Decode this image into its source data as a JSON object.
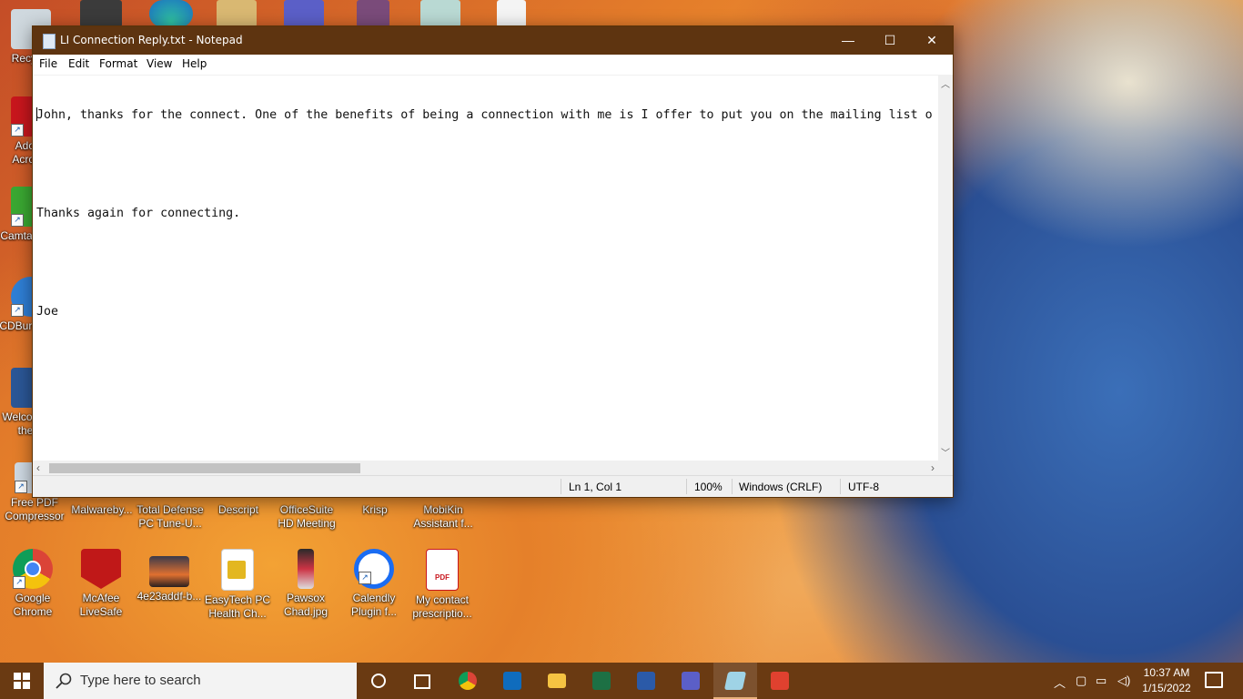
{
  "desktop": {
    "left_icons": [
      {
        "label": "Recycle",
        "icon": "recycle-bin-icon"
      },
      {
        "label": "Adobe Acrobat",
        "icon": "acrobat-icon"
      },
      {
        "label": "Camtasia 20",
        "icon": "camtasia-icon"
      },
      {
        "label": "CDBurnerXP",
        "icon": "cdburner-icon"
      },
      {
        "label": "Welcome to the w",
        "icon": "word-doc-icon"
      }
    ],
    "row1_icons": [
      {
        "label": "Free PDF Compressor",
        "icon": "pdf-compressor-icon"
      },
      {
        "label": "Malwareby...",
        "icon": "malwarebytes-icon"
      },
      {
        "label": "Total Defense PC Tune-U...",
        "icon": "total-defense-icon"
      },
      {
        "label": "Descript",
        "icon": "descript-icon"
      },
      {
        "label": "OfficeSuite HD Meeting",
        "icon": "officesuite-icon"
      },
      {
        "label": "Krisp",
        "icon": "krisp-icon"
      },
      {
        "label": "MobiKin Assistant f...",
        "icon": "mobikin-icon"
      }
    ],
    "row2_icons": [
      {
        "label": "Google Chrome",
        "icon": "chrome-icon"
      },
      {
        "label": "McAfee LiveSafe",
        "icon": "mcafee-icon"
      },
      {
        "label": "4e23addf-b...",
        "icon": "image-file-icon"
      },
      {
        "label": "EasyTech PC Health Ch...",
        "icon": "easytech-icon"
      },
      {
        "label": "Pawsox Chad.jpg",
        "icon": "jpg-file-icon"
      },
      {
        "label": "Calendly Plugin f...",
        "icon": "calendly-icon"
      },
      {
        "label": "My contact prescriptio...",
        "icon": "pdf-file-icon"
      }
    ]
  },
  "notepad": {
    "title": "LI Connection Reply.txt - Notepad",
    "menu": [
      "File",
      "Edit",
      "Format",
      "View",
      "Help"
    ],
    "lines": [
      "John, thanks for the connect. One of the benefits of being a connection with me is I offer to put you on the mailing list o",
      "",
      "Thanks again for connecting.",
      "",
      "Joe"
    ],
    "status": {
      "position": "Ln 1, Col 1",
      "zoom": "100%",
      "line_ending": "Windows (CRLF)",
      "encoding": "UTF-8"
    },
    "window_buttons": {
      "minimize": "—",
      "maximize": "☐",
      "close": "✕"
    }
  },
  "taskbar": {
    "search_placeholder": "Type here to search",
    "apps": [
      "cortana-icon",
      "task-view-icon",
      "chrome-icon",
      "outlook-icon",
      "file-explorer-icon",
      "excel-icon",
      "word-icon",
      "teams-icon",
      "notepad-icon",
      "snagit-icon"
    ],
    "time": "10:37 AM",
    "date": "1/15/2022"
  },
  "colors": {
    "titlebar": "#5e3410",
    "taskbar": "#6a3a12"
  }
}
